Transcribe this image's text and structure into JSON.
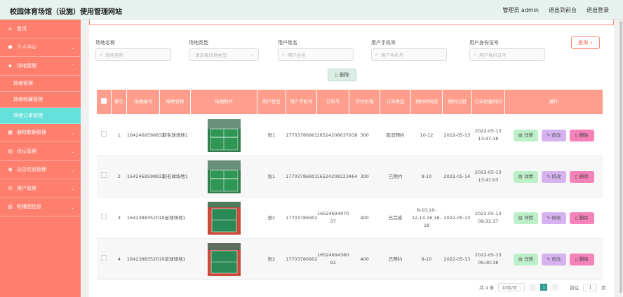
{
  "app": {
    "title": "校园体育场馆（设施）使用管理网站"
  },
  "topbar": {
    "admin": "管理员 admin",
    "back_front": "退出到前台",
    "logout": "退出登录"
  },
  "sidebar": {
    "items": [
      {
        "label": "首页",
        "icon": "home-icon"
      },
      {
        "label": "个人中心",
        "icon": "user-icon"
      },
      {
        "label": "场地管理",
        "icon": "venue-icon"
      }
    ],
    "subitems": [
      "场地管理",
      "场地收藏管理",
      "场地订单管理"
    ],
    "items2": [
      {
        "label": "器材数据管理",
        "icon": "equipment-icon"
      },
      {
        "label": "论坛管理",
        "icon": "forum-icon"
      },
      {
        "label": "公告信息管理",
        "icon": "notice-icon"
      },
      {
        "label": "用户管理",
        "icon": "users-icon"
      },
      {
        "label": "轮播图信息",
        "icon": "carousel-icon"
      }
    ]
  },
  "search": {
    "fields": [
      {
        "label": "场地名称",
        "placeholder": "场地名称"
      },
      {
        "label": "场地类型",
        "placeholder": "请选择场地类型"
      },
      {
        "label": "用户姓名",
        "placeholder": "用户姓名"
      },
      {
        "label": "用户手机号",
        "placeholder": "用户手机号"
      },
      {
        "label": "用户身份证号",
        "placeholder": "用户身份证号"
      }
    ],
    "button": "查询"
  },
  "batch_delete": "删除",
  "table": {
    "headers": [
      "索引",
      "场地编号",
      "场地名称",
      "场地照片",
      "用户姓名",
      "用户手机号",
      "订单号",
      "实付价格",
      "订单类型",
      "预约时间段",
      "预约日期",
      "订单创建时间",
      "操作"
    ],
    "rows": [
      {
        "index": "1",
        "code": "1642469598832",
        "name": "羽毛球场地1",
        "user": "张1",
        "phone": "17703786901",
        "order": "16524208037918",
        "price": "300",
        "type": "取消预约",
        "slot": "10-12",
        "date": "2022-05-13",
        "created": "2022-05-13 13:47:18"
      },
      {
        "index": "2",
        "code": "1642469598832",
        "name": "羽毛球场地1",
        "user": "张1",
        "phone": "17703786901",
        "order": "16524208223464",
        "price": "300",
        "type": "已预约",
        "slot": "8-10",
        "date": "2022-05-14",
        "created": "2022-05-13 13:47:03"
      },
      {
        "index": "3",
        "code": "1642388352019",
        "name": "足球场地1",
        "user": "张2",
        "phone": "17703786902",
        "order": "16524694970 37",
        "price": "400",
        "type": "已完成",
        "slot": "8-10,10-12,14-16,16-18",
        "date": "2022-05-13",
        "created": "2022-05-13 09:31:37"
      },
      {
        "index": "4",
        "code": "1642388352019",
        "name": "足球场地1",
        "user": "张2",
        "phone": "17703786902",
        "order": "16524694380 92",
        "price": "400",
        "type": "已预约",
        "slot": "8-10",
        "date": "2022-05-13",
        "created": "2022-05-13 09:30:38"
      }
    ],
    "ops": {
      "detail": "详情",
      "edit": "修改",
      "delete": "删除"
    }
  },
  "pager": {
    "total": "共 4 条",
    "size": "10条/页",
    "page": "1",
    "goto": "前往",
    "page_input": "1",
    "page_unit": "页"
  }
}
